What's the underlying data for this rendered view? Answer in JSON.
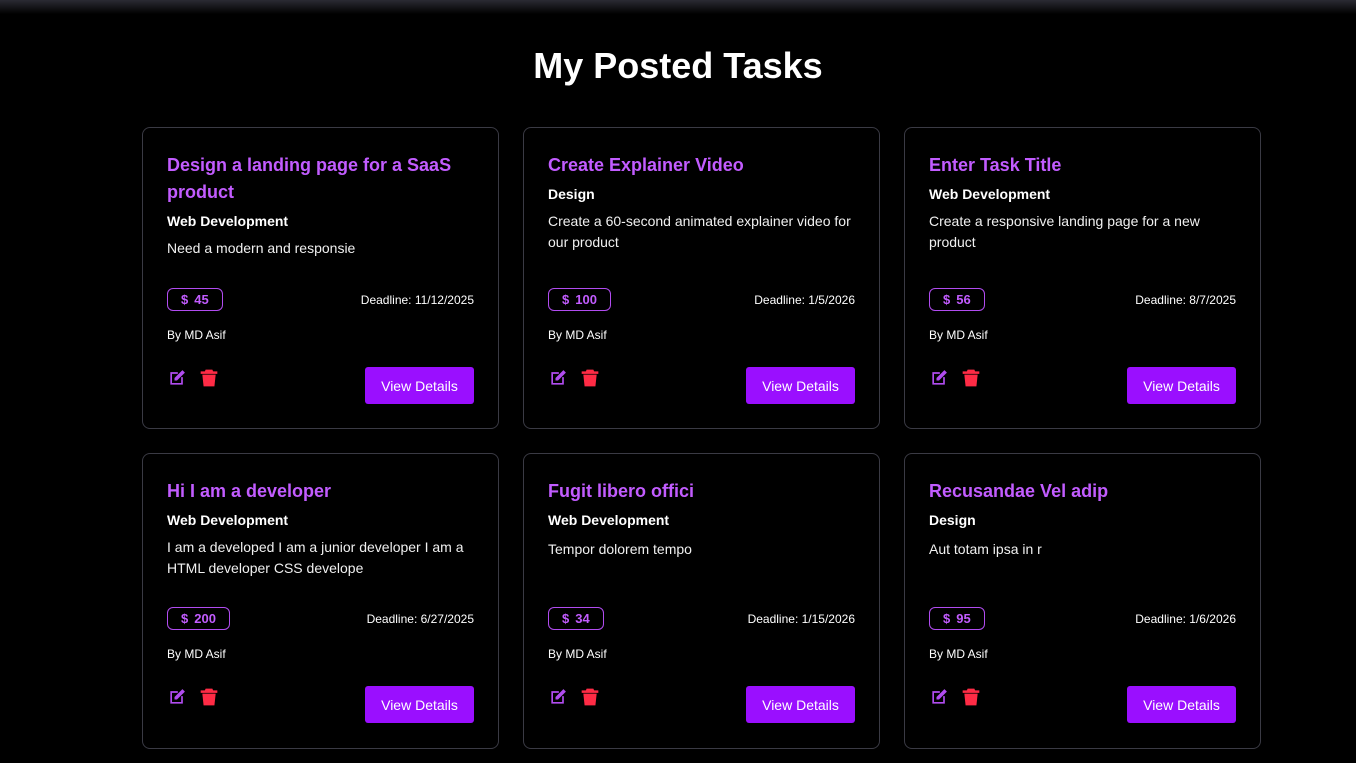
{
  "page": {
    "title": "My Posted Tasks"
  },
  "labels": {
    "view_details": "View Details",
    "currency": "$"
  },
  "colors": {
    "accent": "#9a0fff",
    "title": "#c25cff",
    "delete": "#ff2b45",
    "edit": "#b14cf0"
  },
  "icons": {
    "edit": "edit-icon",
    "delete": "trash-icon"
  },
  "tasks": [
    {
      "title": "Design a landing page for a SaaS product",
      "category": "Web Development",
      "description": "Need a modern and responsie",
      "budget": "45",
      "deadline": "Deadline: 11/12/2025",
      "author": "By MD Asif"
    },
    {
      "title": "Create Explainer Video",
      "category": "Design",
      "description": "Create a 60-second animated explainer video for our product",
      "budget": "100",
      "deadline": "Deadline: 1/5/2026",
      "author": "By MD Asif"
    },
    {
      "title": "Enter Task Title",
      "category": "Web Development",
      "description": "Create a responsive landing page for a new product",
      "budget": "56",
      "deadline": "Deadline: 8/7/2025",
      "author": "By MD Asif"
    },
    {
      "title": "Hi I am a developer",
      "category": "Web Development",
      "description": "I am a developed I am a junior developer I am a HTML developer CSS develope",
      "budget": "200",
      "deadline": "Deadline: 6/27/2025",
      "author": "By MD Asif"
    },
    {
      "title": "Fugit libero offici",
      "category": "Web Development",
      "description": "Tempor dolorem tempo",
      "budget": "34",
      "deadline": "Deadline: 1/15/2026",
      "author": "By MD Asif"
    },
    {
      "title": "Recusandae Vel adip",
      "category": "Design",
      "description": "Aut totam ipsa in r",
      "budget": "95",
      "deadline": "Deadline: 1/6/2026",
      "author": "By MD Asif"
    }
  ]
}
